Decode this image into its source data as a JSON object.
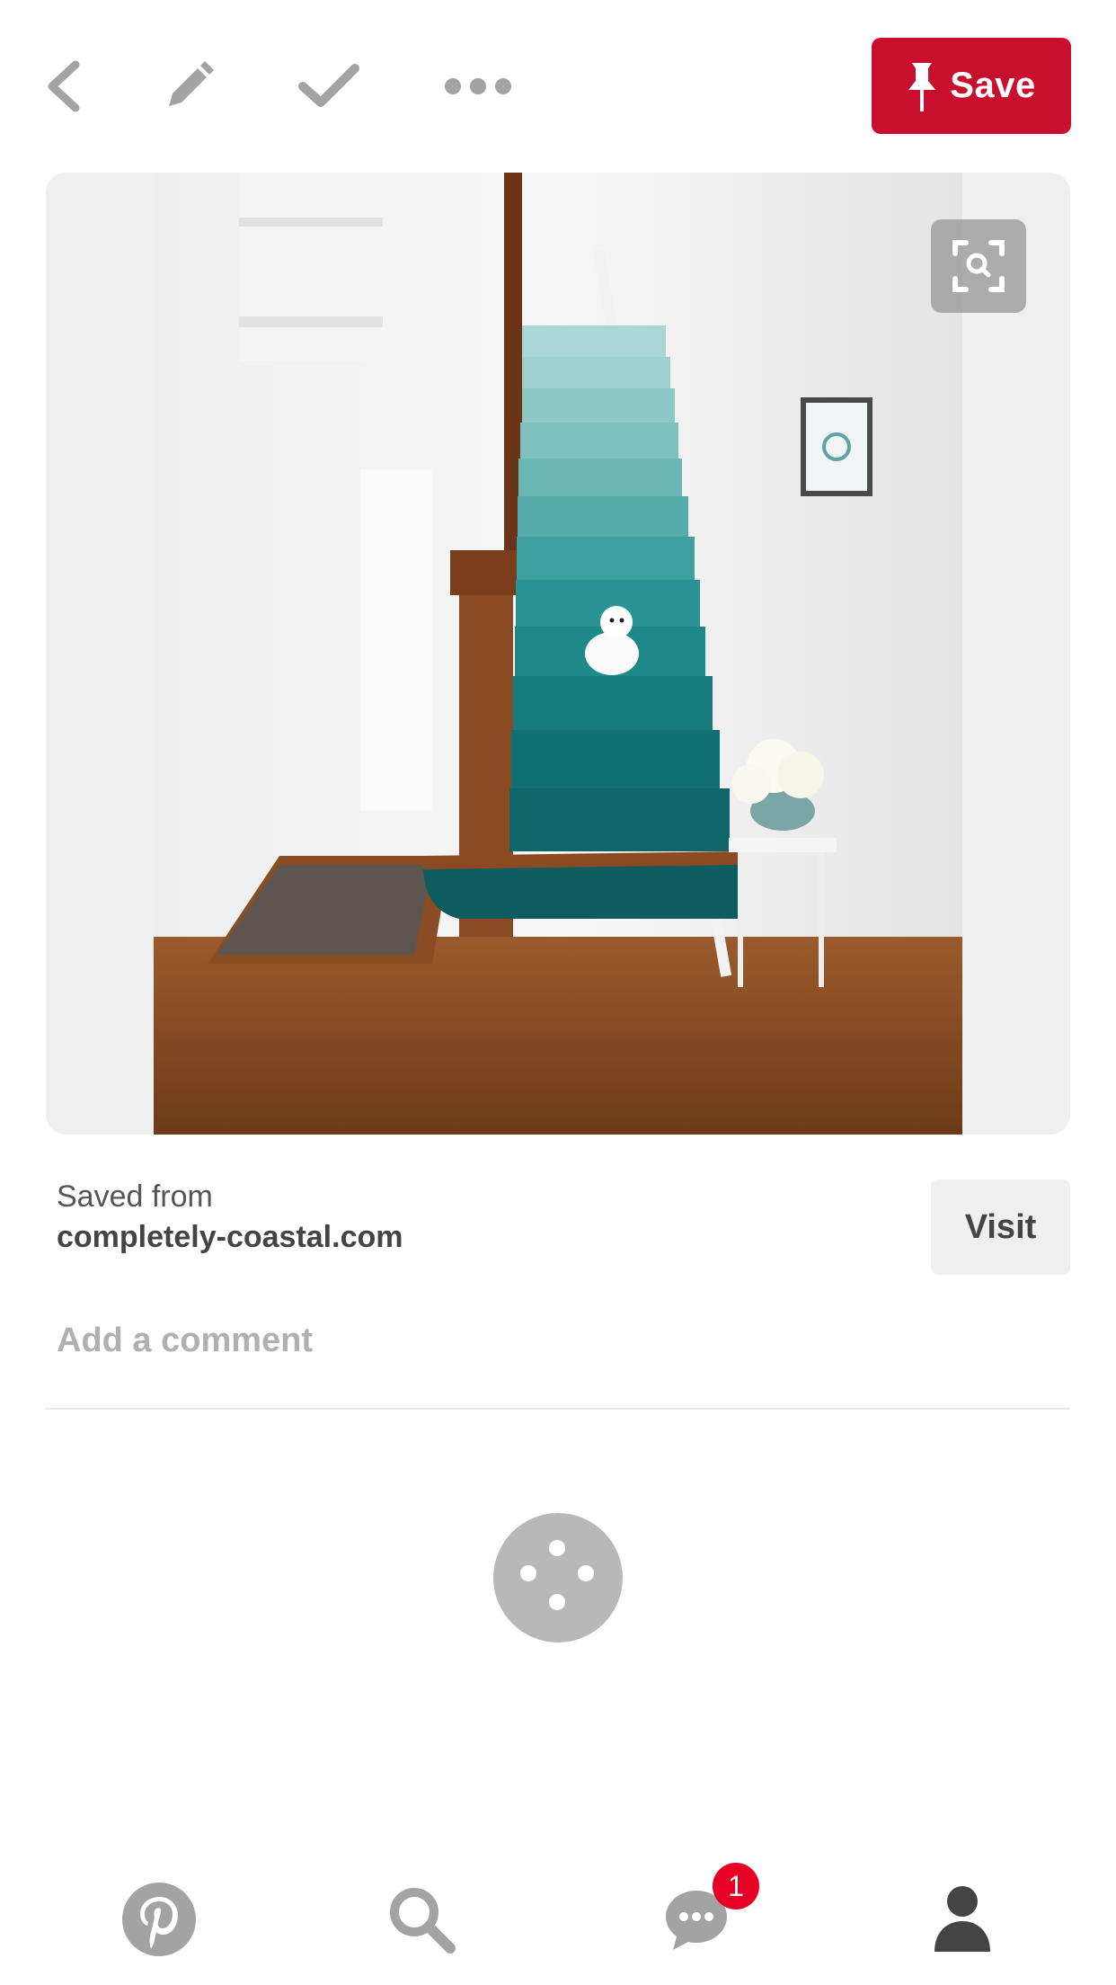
{
  "toolbar": {
    "back_icon": "chevron-left-icon",
    "edit_icon": "pencil-icon",
    "done_icon": "checkmark-icon",
    "more_icon": "ellipsis-icon",
    "save_label": "Save",
    "save_icon": "pushpin-icon"
  },
  "pin": {
    "image_description": "",
    "visual_search_icon": "visual-search-icon"
  },
  "source": {
    "label": "Saved from",
    "domain": "completely-coastal.com",
    "visit_label": "Visit"
  },
  "comment": {
    "placeholder": "Add a comment"
  },
  "tabbar": {
    "items": [
      {
        "icon": "pinterest-logo-icon"
      },
      {
        "icon": "search-icon"
      },
      {
        "icon": "chat-bubble-icon",
        "badge": "1"
      },
      {
        "icon": "profile-icon"
      }
    ]
  },
  "colors": {
    "brand_red": "#c8102e",
    "badge_red": "#e60023",
    "icon_gray": "#a0a0a0",
    "profile_dark": "#444444"
  }
}
